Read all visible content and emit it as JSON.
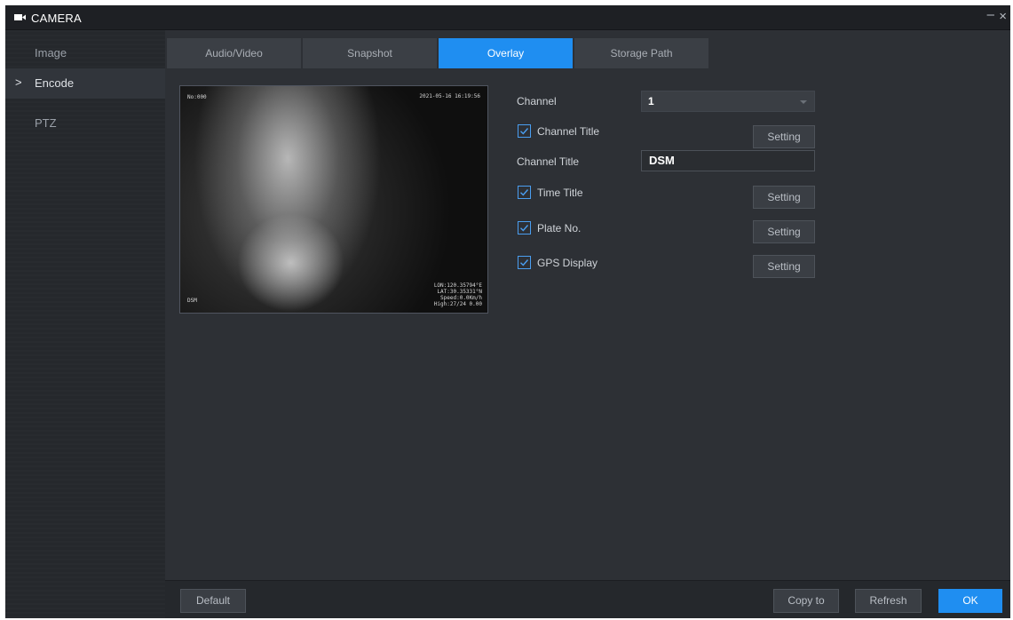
{
  "window": {
    "title": "CAMERA",
    "minimize_glyph": "–",
    "close_glyph": "×"
  },
  "sidebar": {
    "items": [
      {
        "label": "Image",
        "active": false
      },
      {
        "label": "Encode",
        "active": true,
        "chevron": ">"
      },
      {
        "label": "PTZ",
        "active": false
      }
    ]
  },
  "tabs": [
    {
      "label": "Audio/Video"
    },
    {
      "label": "Snapshot"
    },
    {
      "label": "Overlay",
      "active": true
    },
    {
      "label": "Storage Path"
    }
  ],
  "preview": {
    "osd_top_left": "No:000",
    "osd_top_right": "2021-05-16 16:19:56",
    "osd_bottom_left": "DSM",
    "osd_bottom_right": "LON:120.35794°E\nLAT:30.35331°N\nSpeed:0.0Km/h\nHigh:27/24 0.00"
  },
  "form": {
    "channel_label": "Channel",
    "channel_value": "1",
    "channel_title_check_label": "Channel Title",
    "channel_title_checked": true,
    "channel_title_field_label": "Channel Title",
    "channel_title_value": "DSM",
    "time_title_label": "Time Title",
    "time_title_checked": true,
    "plate_no_label": "Plate No.",
    "plate_no_checked": true,
    "gps_display_label": "GPS Display",
    "gps_display_checked": true,
    "setting_label": "Setting"
  },
  "bottom": {
    "default_label": "Default",
    "copy_to_label": "Copy to",
    "refresh_label": "Refresh",
    "ok_label": "OK"
  },
  "colors": {
    "accent": "#1f8ef1",
    "background": "#2d3035",
    "sidebar": "#25282c"
  },
  "icons": {
    "title": "camera-icon",
    "checkbox": "checkmark-icon",
    "select": "chevron-down-icon"
  }
}
